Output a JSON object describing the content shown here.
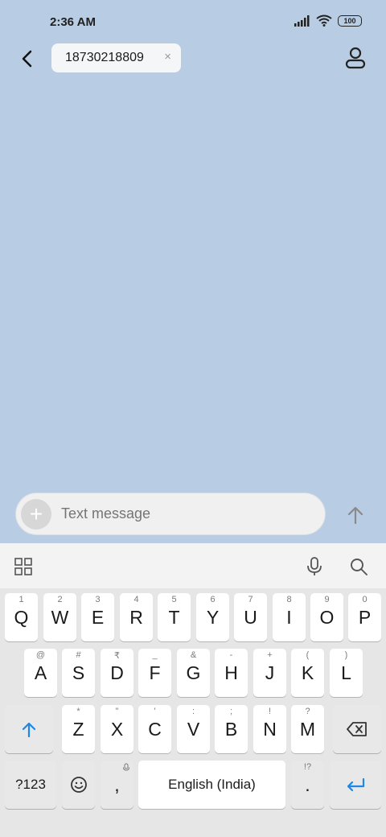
{
  "status_bar": {
    "time": "2:36 AM",
    "battery": "100"
  },
  "header": {
    "recipient": "18730218809",
    "chip_close": "×"
  },
  "compose": {
    "placeholder": "Text message",
    "attach_symbol": "+"
  },
  "keyboard": {
    "row1": [
      {
        "label": "Q",
        "hint": "1"
      },
      {
        "label": "W",
        "hint": "2"
      },
      {
        "label": "E",
        "hint": "3"
      },
      {
        "label": "R",
        "hint": "4"
      },
      {
        "label": "T",
        "hint": "5"
      },
      {
        "label": "Y",
        "hint": "6"
      },
      {
        "label": "U",
        "hint": "7"
      },
      {
        "label": "I",
        "hint": "8"
      },
      {
        "label": "O",
        "hint": "9"
      },
      {
        "label": "P",
        "hint": "0"
      }
    ],
    "row2": [
      {
        "label": "A",
        "hint": "@"
      },
      {
        "label": "S",
        "hint": "#"
      },
      {
        "label": "D",
        "hint": "₹"
      },
      {
        "label": "F",
        "hint": "_"
      },
      {
        "label": "G",
        "hint": "&"
      },
      {
        "label": "H",
        "hint": "-"
      },
      {
        "label": "J",
        "hint": "+"
      },
      {
        "label": "K",
        "hint": "("
      },
      {
        "label": "L",
        "hint": ")"
      }
    ],
    "row3": [
      {
        "label": "Z",
        "hint": "*"
      },
      {
        "label": "X",
        "hint": "\""
      },
      {
        "label": "C",
        "hint": "'"
      },
      {
        "label": "V",
        "hint": ":"
      },
      {
        "label": "B",
        "hint": ";"
      },
      {
        "label": "N",
        "hint": "!"
      },
      {
        "label": "M",
        "hint": "?"
      }
    ],
    "symbols_key": "?123",
    "comma_key": ",",
    "space_key": "English (India)",
    "period_key": ".",
    "period_hint": "!?"
  },
  "colors": {
    "background": "#b8cde3",
    "accent": "#1e88e5"
  }
}
